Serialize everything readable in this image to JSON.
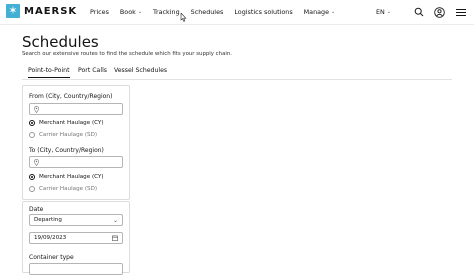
{
  "brand": {
    "name": "MAERSK",
    "accent": "#42b0d5"
  },
  "nav": {
    "items": [
      {
        "label": "Prices",
        "has_menu": false
      },
      {
        "label": "Book",
        "has_menu": true
      },
      {
        "label": "Tracking",
        "has_menu": false
      },
      {
        "label": "Schedules",
        "has_menu": false
      },
      {
        "label": "Logistics solutions",
        "has_menu": false
      },
      {
        "label": "Manage",
        "has_menu": true
      }
    ],
    "language": "EN",
    "icons": [
      "search-icon",
      "user-icon",
      "menu-icon"
    ]
  },
  "page": {
    "title": "Schedules",
    "subtitle": "Search our extensive routes to find the schedule which fits your supply chain."
  },
  "tabs": [
    {
      "label": "Point-to-Point",
      "active": true
    },
    {
      "label": "Port Calls",
      "active": false
    },
    {
      "label": "Vessel Schedules",
      "active": false
    }
  ],
  "form": {
    "from_label": "From (City, Country/Region)",
    "from_value": "",
    "from_haulage": {
      "option1": "Merchant Haulage (CY)",
      "option2": "Carrier Haulage (SD)",
      "selected": "option1"
    },
    "to_label": "To (City, Country/Region)",
    "to_value": "",
    "to_haulage": {
      "option1": "Merchant Haulage (CY)",
      "option2": "Carrier Haulage (SD)",
      "selected": "option1"
    },
    "date_label": "Date",
    "date_mode": "Departing",
    "date_value": "19/09/2023",
    "container_label": "Container type"
  }
}
